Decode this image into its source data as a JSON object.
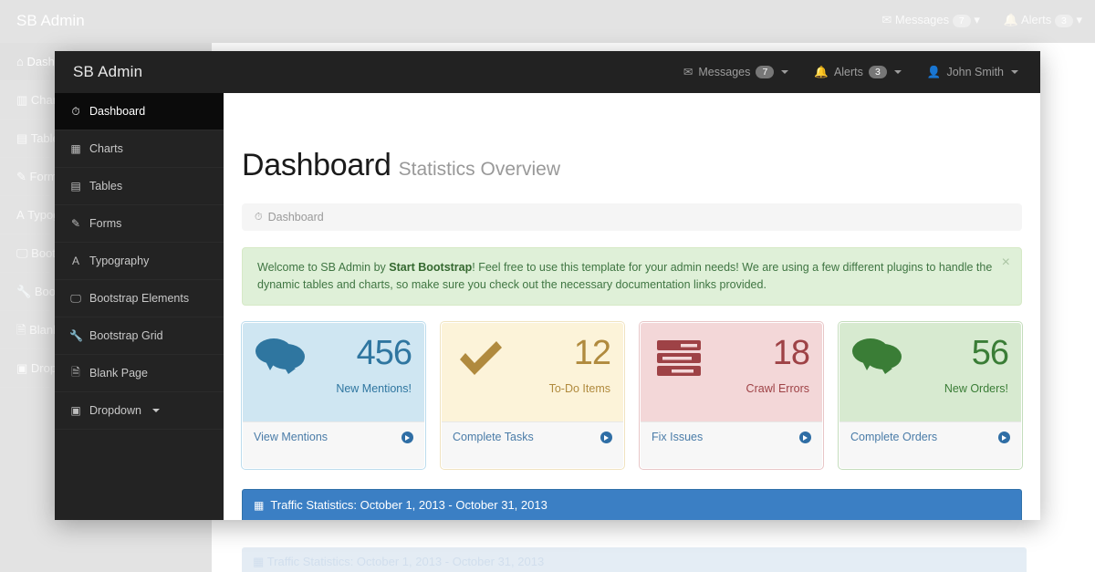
{
  "app": {
    "brand": "SB Admin"
  },
  "topnav": {
    "messages": {
      "label": "Messages",
      "count": "7",
      "icon": "envelope-icon"
    },
    "alerts": {
      "label": "Alerts",
      "count": "3",
      "icon": "bell-icon"
    },
    "user": {
      "label": "John Smith",
      "icon": "user-icon"
    }
  },
  "sidebar": {
    "items": [
      {
        "label": "Dashboard",
        "icon": "dashboard-icon",
        "active": true,
        "dropdown": false
      },
      {
        "label": "Charts",
        "icon": "bar-chart-icon",
        "active": false,
        "dropdown": false
      },
      {
        "label": "Tables",
        "icon": "table-icon",
        "active": false,
        "dropdown": false
      },
      {
        "label": "Forms",
        "icon": "edit-icon",
        "active": false,
        "dropdown": false
      },
      {
        "label": "Typography",
        "icon": "font-icon",
        "active": false,
        "dropdown": false
      },
      {
        "label": "Bootstrap Elements",
        "icon": "desktop-icon",
        "active": false,
        "dropdown": false
      },
      {
        "label": "Bootstrap Grid",
        "icon": "wrench-icon",
        "active": false,
        "dropdown": false
      },
      {
        "label": "Blank Page",
        "icon": "file-icon",
        "active": false,
        "dropdown": false
      },
      {
        "label": "Dropdown",
        "icon": "caret-square-icon",
        "active": false,
        "dropdown": true
      }
    ]
  },
  "page": {
    "title": "Dashboard",
    "subtitle": "Statistics Overview",
    "breadcrumb": {
      "icon": "dashboard-icon",
      "label": "Dashboard"
    }
  },
  "alert": {
    "text_before": "Welcome to SB Admin by ",
    "bold": "Start Bootstrap",
    "text_after": "! Feel free to use this template for your admin needs! We are using a few different plugins to handle the dynamic tables and charts, so make sure you check out the necessary documentation links provided.",
    "close_label": "×",
    "background": "#dff0d8",
    "text_color": "#3f7542"
  },
  "panels": [
    {
      "value": "456",
      "label": "New Mentions!",
      "footer": "View Mentions",
      "icon": "comments-icon",
      "style": "info",
      "bg": "#cfe6f2",
      "fg": "#2f76a0"
    },
    {
      "value": "12",
      "label": "To-Do Items",
      "footer": "Complete Tasks",
      "icon": "check-icon",
      "style": "warning",
      "bg": "#fcf3d9",
      "fg": "#b08a3e"
    },
    {
      "value": "18",
      "label": "Crawl Errors",
      "footer": "Fix Issues",
      "icon": "tasks-icon",
      "style": "danger",
      "bg": "#f3d7d8",
      "fg": "#9e4246"
    },
    {
      "value": "56",
      "label": "New Orders!",
      "footer": "Complete Orders",
      "icon": "comments-icon",
      "style": "success",
      "bg": "#d7ead0",
      "fg": "#3a7d36"
    }
  ],
  "traffic_panel": {
    "icon": "bar-chart-icon",
    "title": "Traffic Statistics: October 1, 2013 - October 31, 2013",
    "header_bg": "#3b7fc4"
  }
}
